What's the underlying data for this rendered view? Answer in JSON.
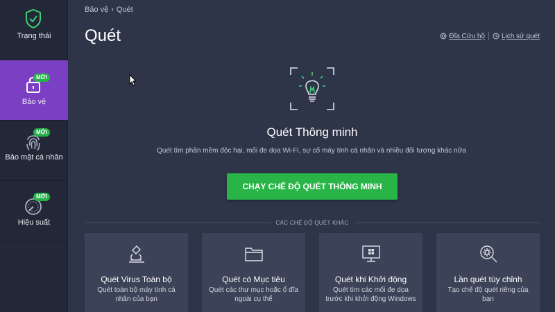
{
  "sidebar": {
    "items": [
      {
        "label": "Trạng thái",
        "icon": "shield-check-icon",
        "badge": ""
      },
      {
        "label": "Bảo vệ",
        "icon": "lock-icon",
        "badge": "MỚI"
      },
      {
        "label": "Bảo mật cá nhân",
        "icon": "fingerprint-icon",
        "badge": "MỚI"
      },
      {
        "label": "Hiệu suất",
        "icon": "gauge-icon",
        "badge": "MỚI"
      }
    ]
  },
  "breadcrumb": {
    "parent": "Bảo vệ",
    "separator": "›",
    "current": "Quét"
  },
  "page": {
    "title": "Quét"
  },
  "links": {
    "rescue_disk": "Đĩa Cứu hộ",
    "scan_history": "Lịch sử quét"
  },
  "hero": {
    "title": "Quét Thông minh",
    "subtitle": "Quét tìm phần mềm độc hại, mối đe dọa Wi-Fi, sự cố máy tính cá nhân và nhiều đối tượng khác nữa",
    "button": "CHẠY CHẾ ĐỘ QUÉT THÔNG MINH"
  },
  "other_modes_label": "CÁC CHẾ ĐỘ QUÉT KHÁC",
  "cards": [
    {
      "title": "Quét Virus Toàn bộ",
      "desc": "Quét toàn bộ máy tính cá nhân của bạn",
      "icon": "microscope-icon"
    },
    {
      "title": "Quét có Mục tiêu",
      "desc": "Quét các thư mục hoặc ổ đĩa ngoài cụ thể",
      "icon": "folder-icon"
    },
    {
      "title": "Quét khi Khởi động",
      "desc": "Quét tìm các mối đe dọa trước khi khởi động Windows",
      "icon": "monitor-windows-icon"
    },
    {
      "title": "Lần quét tùy chỉnh",
      "desc": "Tạo chế độ quét riêng của bạn",
      "icon": "magnifier-gear-icon"
    }
  ],
  "colors": {
    "sidebar_bg": "#232838",
    "active_nav": "#7a3fc3",
    "main_bg": "#2f3549",
    "card_bg": "#3c4257",
    "accent_green": "#28b446",
    "icon_green": "#3ecf72"
  }
}
